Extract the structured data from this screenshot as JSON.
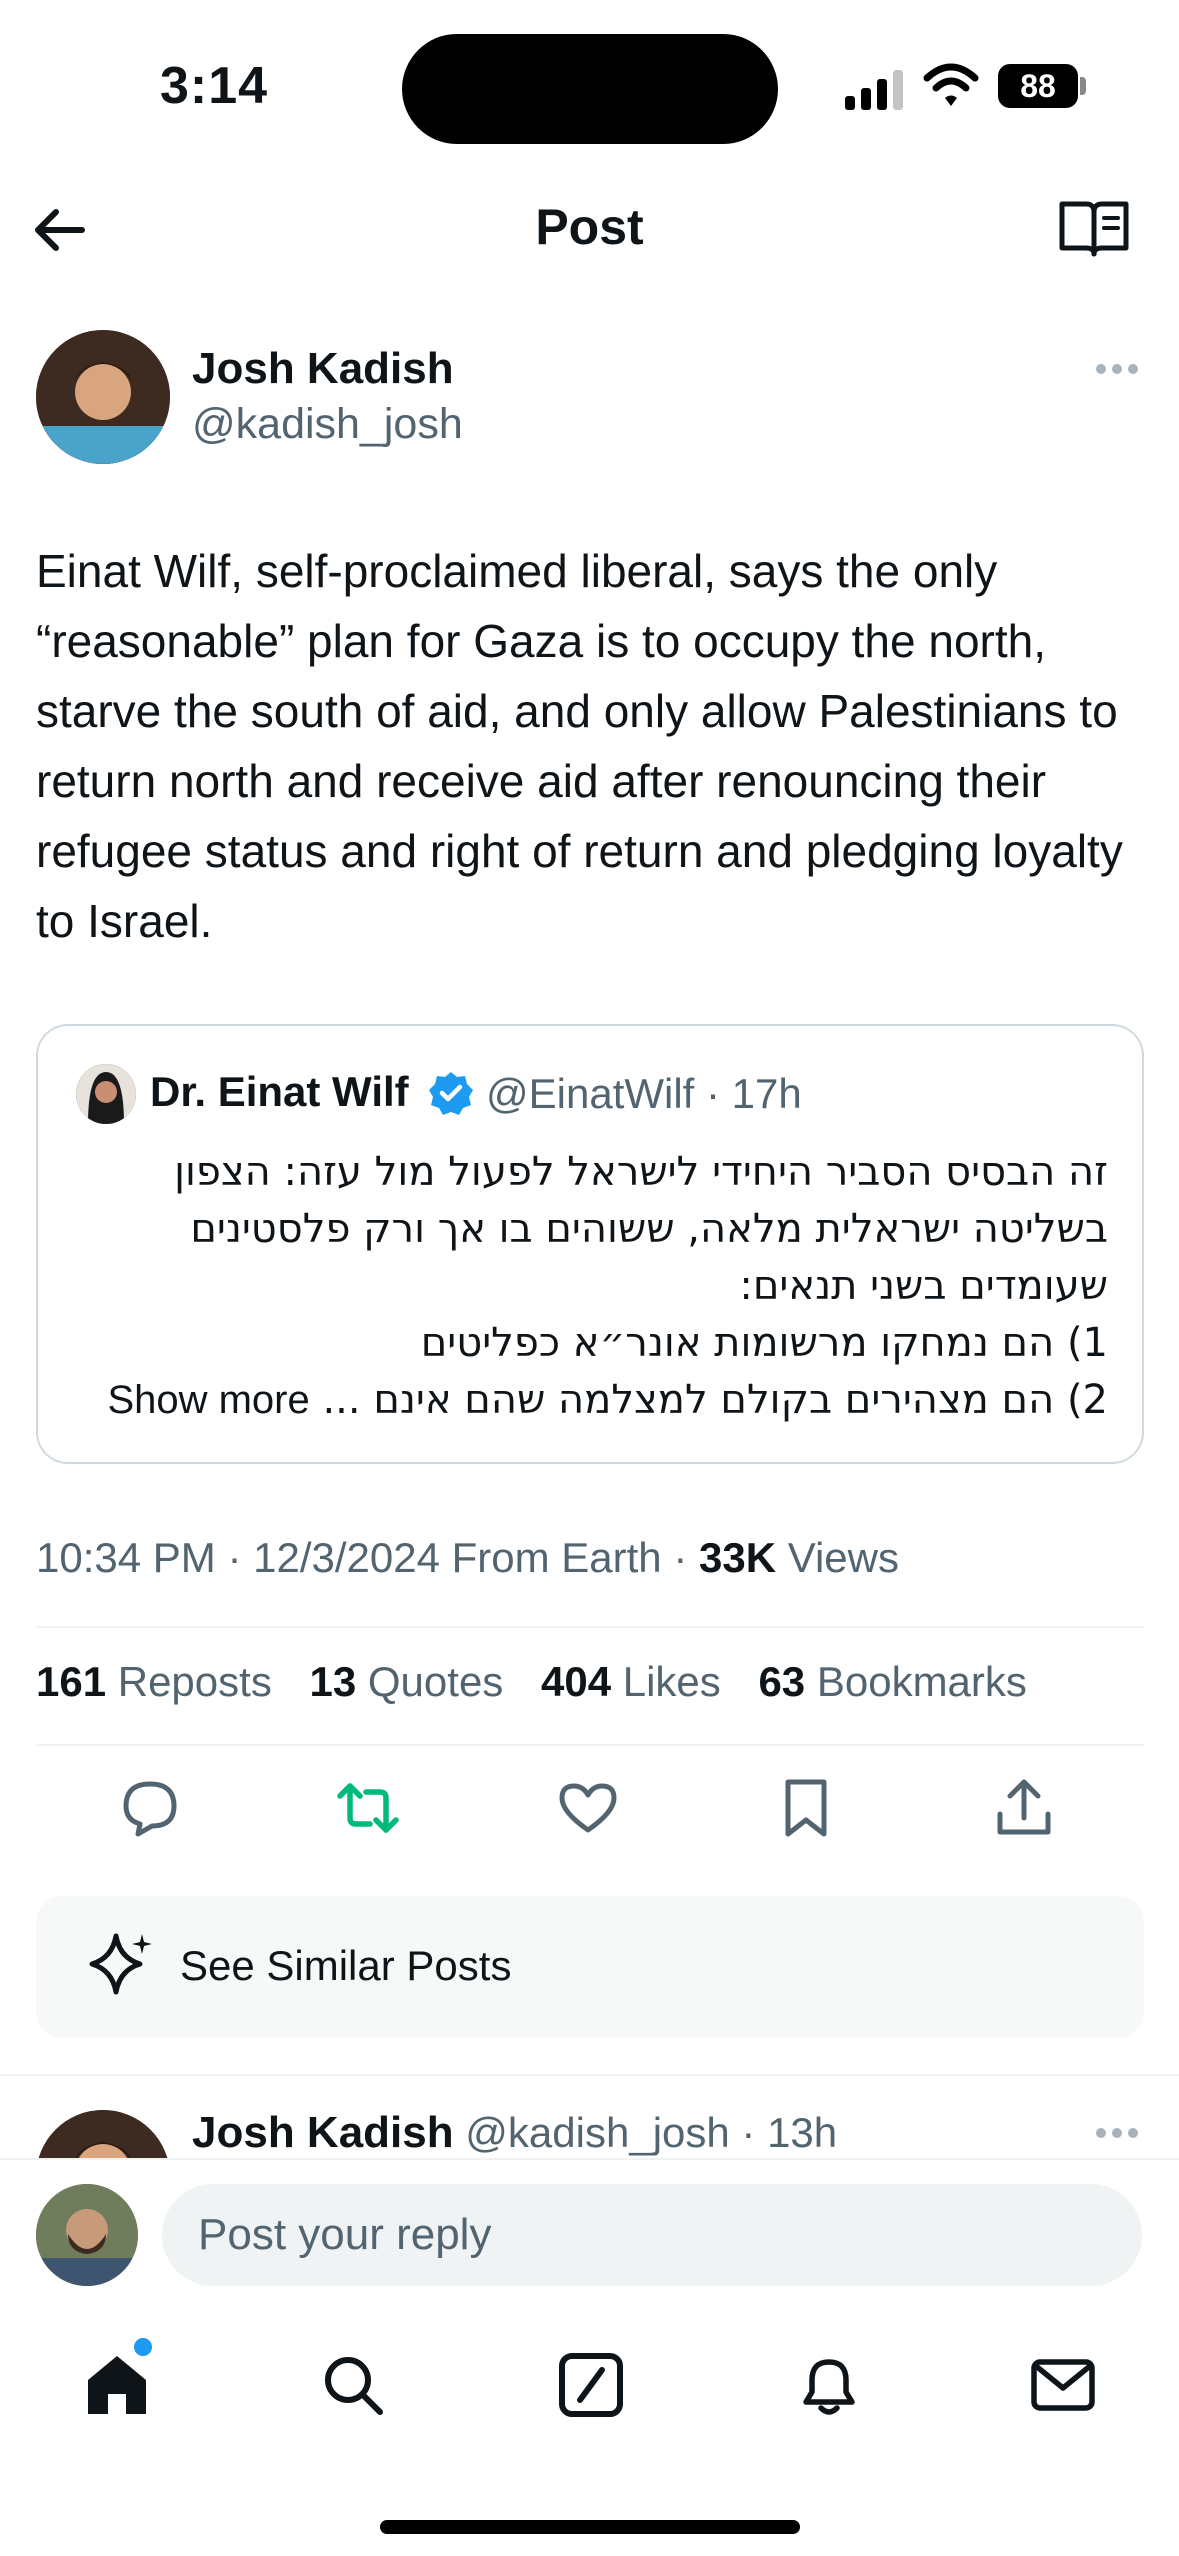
{
  "status_bar": {
    "time": "3:14",
    "battery": "88"
  },
  "header": {
    "title": "Post"
  },
  "post": {
    "author_name": "Josh Kadish",
    "author_handle": "@kadish_josh",
    "text": "Einat Wilf, self-proclaimed liberal, says the only “reasonable” plan for Gaza is to occupy the north, starve the south of aid, and only allow Palestinians to return north and receive aid after renouncing their refugee status and right of return and pledging loyalty to Israel.",
    "timestamp": "10:34 PM · 12/3/2024 From Earth · ",
    "views_count": "33K",
    "views_label": " Views"
  },
  "quote": {
    "name": "Dr. Einat Wilf",
    "handle_time": "@EinatWilf · 17h",
    "lines": [
      "זה הבסיס הסביר היחידי לישראל לפעול מול עזה: הצפון",
      "בשליטה ישראלית מלאה, ששוהים בו אך ורק פלסטינים",
      "שעומדים בשני תנאים:",
      "1) הם נמחקו מרשומות אונר״א כפליטים",
      "2) הם מצהירים בקולם למצלמה שהם אינם ..."
    ],
    "show_more": "Show more"
  },
  "stats": {
    "reposts_count": "161",
    "reposts_label": " Reposts",
    "quotes_count": "13",
    "quotes_label": " Quotes",
    "likes_count": "404",
    "likes_label": " Likes",
    "bookmarks_count": "63",
    "bookmarks_label": " Bookmarks"
  },
  "similar": {
    "label": "See Similar Posts"
  },
  "reply_preview": {
    "author_name": "Josh Kadish",
    "meta": " @kadish_josh · 13h"
  },
  "composer": {
    "placeholder": "Post your reply"
  },
  "colors": {
    "accent": "#1d9bf0",
    "repost_active": "#00ba7c",
    "secondary_text": "#536471"
  }
}
